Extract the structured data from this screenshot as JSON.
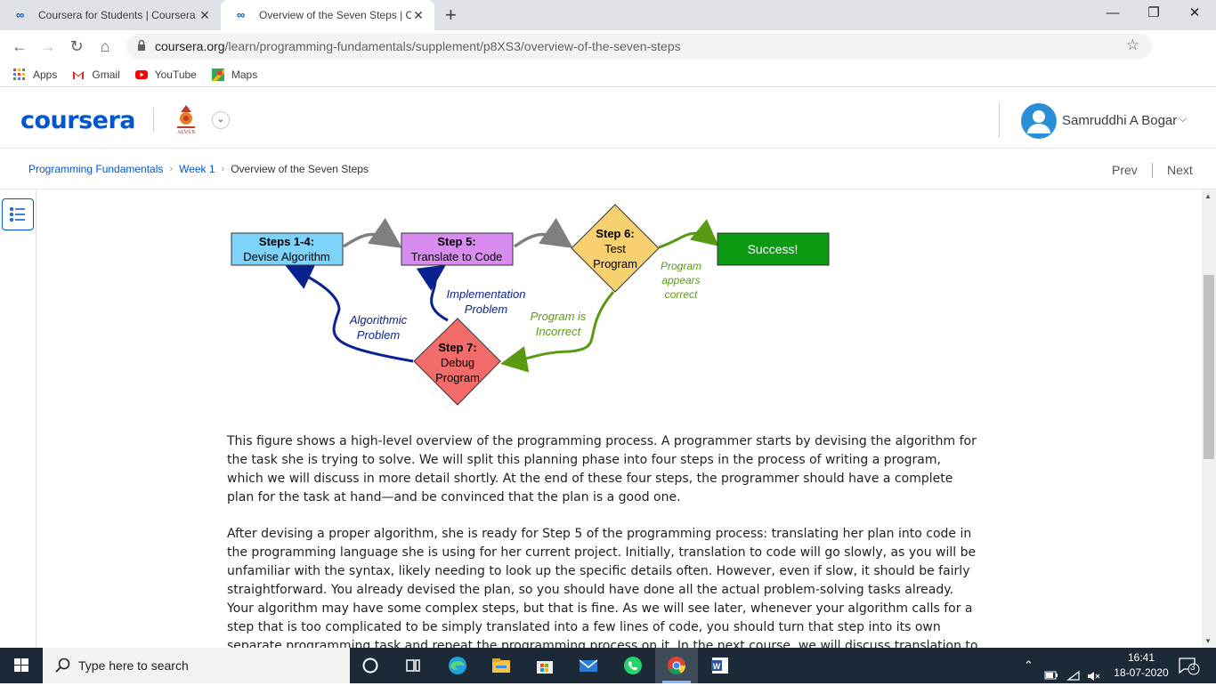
{
  "browser": {
    "tabs": [
      {
        "title": "Coursera for Students | Coursera",
        "active": false
      },
      {
        "title": "Overview of the Seven Steps | Co",
        "active": true
      }
    ],
    "new_tab": "+",
    "url_host": "coursera.org",
    "url_path": "/learn/programming-fundamentals/supplement/p8XS3/overview-of-the-seven-steps",
    "bookmarks": [
      "Apps",
      "Gmail",
      "YouTube",
      "Maps"
    ]
  },
  "header": {
    "logo": "coursera",
    "user_name": "Samruddhi A Bogar"
  },
  "breadcrumb": {
    "items": [
      "Programming Fundamentals",
      "Week 1",
      "Overview of the Seven Steps"
    ],
    "prev": "Prev",
    "next": "Next"
  },
  "diagram": {
    "steps14": [
      "Steps 1-4:",
      "Devise Algorithm"
    ],
    "step5": [
      "Step 5:",
      "Translate to Code"
    ],
    "step6": [
      "Step 6:",
      "Test",
      "Program"
    ],
    "success": "Success!",
    "step7": [
      "Step 7:",
      "Debug",
      "Program"
    ],
    "correct": [
      "Program",
      "appears",
      "correct"
    ],
    "incorrect": [
      "Program is",
      "Incorrect"
    ],
    "implementation": [
      "Implementation",
      "Problem"
    ],
    "algorithmic": [
      "Algorithmic",
      "Problem"
    ],
    "colors": {
      "steps14": "#7dd3fa",
      "step5": "#d98cf0",
      "step6": "#f7d070",
      "success": "#0b9a12",
      "step7": "#f36b6b",
      "blue_arrow": "#0a2290",
      "green_arrow": "#5a9a12",
      "gray_arrow": "#7f7f7f"
    }
  },
  "content": {
    "para1": "This figure shows a high-level overview of the programming process. A programmer starts by devising the algorithm for the task she is trying to solve. We will split this planning phase into four steps in the process of writing a program, which we will discuss in more detail shortly. At the end of these four steps, the programmer should have a complete plan for the task at hand—and be convinced that the plan is a good one.",
    "para2": "After devising a proper algorithm, she is ready for Step 5 of the programming process: translating her plan into code in the programming language she is using for her current project. Initially, translation to code will go slowly, as you will be unfamiliar with the syntax, likely needing to look up the specific details often. However, even if slow, it should be fairly straightforward. You already devised the plan, so you should have done all the actual problem-solving tasks already. Your algorithm may have some complex steps, but that is fine. As we will see later, whenever your algorithm calls for a step that is too complicated to be simply translated into a few lines of code, you should turn that step into its own separate programming task and repeat the programming process on it. In the next course, we will discuss translation to code in much more detail, as well as how to turn the"
  },
  "taskbar": {
    "search_placeholder": "Type here to search",
    "time": "16:41",
    "date": "18-07-2020",
    "notifications": "3"
  }
}
